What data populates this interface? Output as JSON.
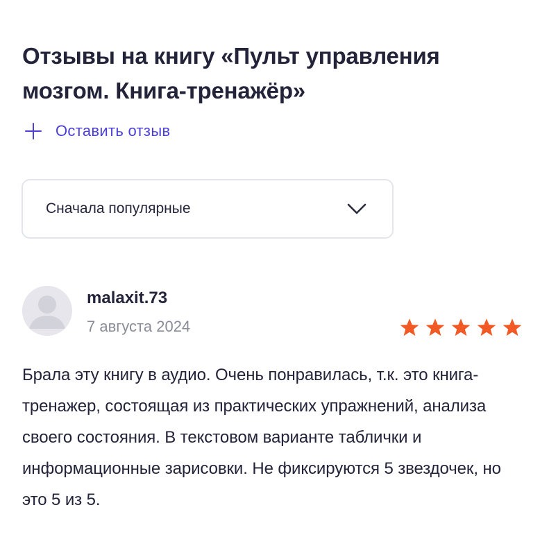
{
  "header": {
    "title": "Отзывы на книгу «Пульт управления мозгом. Книга-тренажёр»"
  },
  "actions": {
    "add_review_label": "Оставить отзыв",
    "add_review_icon": "plus-icon"
  },
  "sort": {
    "selected": "Сначала популярные",
    "icon": "chevron-down-icon"
  },
  "review": {
    "author": "malaxit.73",
    "date": "7 августа 2024",
    "rating": 5,
    "rating_max": 5,
    "text": "Брала эту книгу в аудио. Очень понравилась, т.к. это книга- тренажер, состоящая из практических упражнений, анализа своего состояния. В текстовом варианте таблички и информационные зарисовки. Не фиксируются 5 звездочек, но это 5 из 5."
  },
  "colors": {
    "accent": "#4b3fd6",
    "star": "#f15a24",
    "text": "#23243a",
    "muted": "#8b8c99",
    "border": "#e4e5ec",
    "avatar_bg": "#e6e6ec",
    "avatar_fg": "#c9c9d3"
  }
}
